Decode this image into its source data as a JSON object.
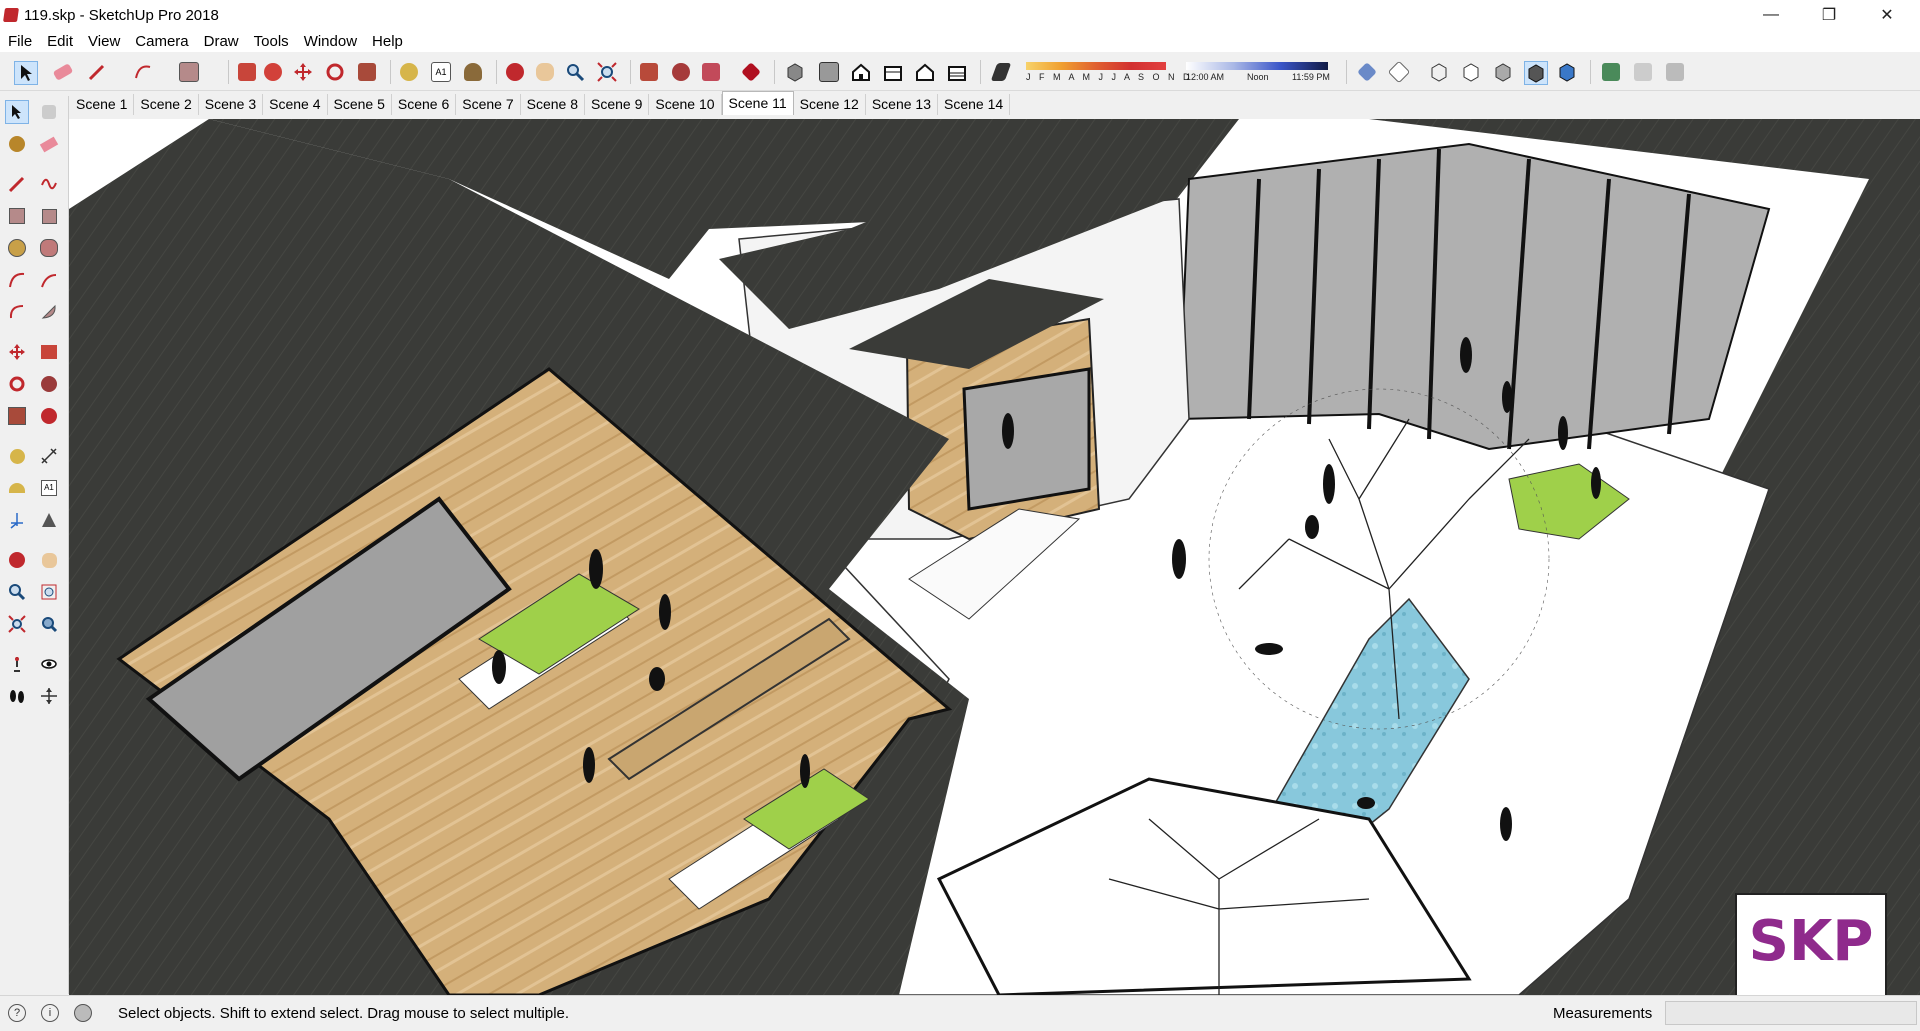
{
  "window": {
    "title": "119.skp - SketchUp Pro 2018"
  },
  "menu": [
    "File",
    "Edit",
    "View",
    "Camera",
    "Draw",
    "Tools",
    "Window",
    "Help"
  ],
  "shadows": {
    "months": "J F M A M J J A S O N D",
    "time_start": "12:00 AM",
    "time_mid": "Noon",
    "time_end": "11:59 PM"
  },
  "scenes": {
    "tabs": [
      "Scene 1",
      "Scene 2",
      "Scene 3",
      "Scene 4",
      "Scene 5",
      "Scene 6",
      "Scene 7",
      "Scene 8",
      "Scene 9",
      "Scene 10",
      "Scene 11",
      "Scene 12",
      "Scene 13",
      "Scene 14"
    ],
    "active": "Scene 11"
  },
  "status": {
    "hint": "Select objects. Shift to extend select. Drag mouse to select multiple.",
    "measurements_label": "Measurements",
    "measurements_value": ""
  },
  "badge": {
    "text": "SKP"
  },
  "colors": {
    "roof": "#3a3b38",
    "wood": "#d2ae78",
    "glass": "#9c9c9c",
    "lawn": "#9fd04a",
    "water": "#7cc4da",
    "badge": "#8f2a8c"
  }
}
